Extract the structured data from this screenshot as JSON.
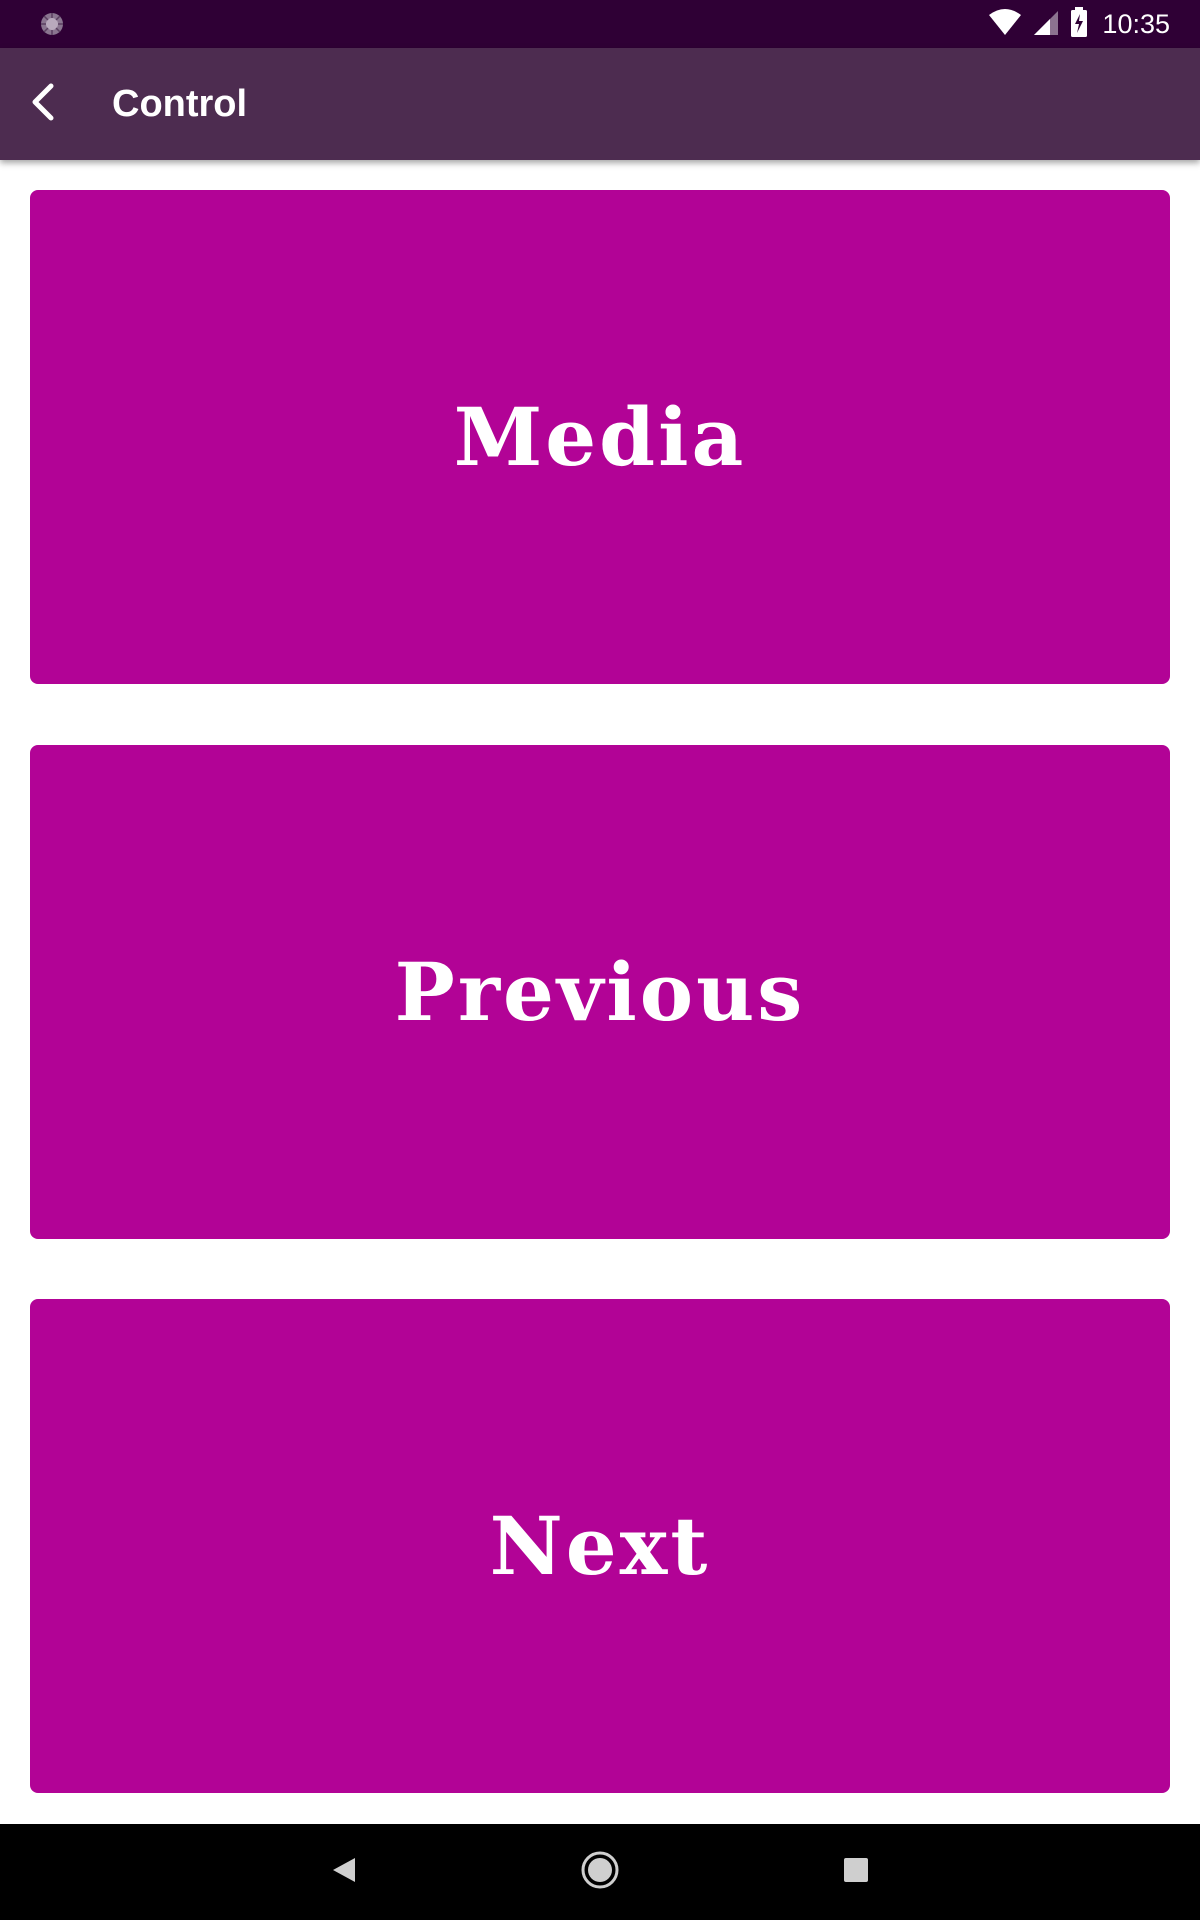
{
  "status_bar": {
    "time": "10:35",
    "icons": [
      "notification-icon",
      "wifi-icon",
      "signal-icon",
      "battery-charging-icon"
    ]
  },
  "app_bar": {
    "title": "Control",
    "back_icon": "back-arrow-icon"
  },
  "buttons": [
    {
      "label": "Media"
    },
    {
      "label": "Previous"
    },
    {
      "label": "Next"
    }
  ],
  "nav_bar": {
    "icons": [
      "nav-back-icon",
      "nav-home-icon",
      "nav-recents-icon"
    ]
  },
  "colors": {
    "status_bar": "#2f0035",
    "app_bar": "#4d2c50",
    "button": "#b20396",
    "button_text": "#ffffff",
    "background": "#ffffff"
  }
}
